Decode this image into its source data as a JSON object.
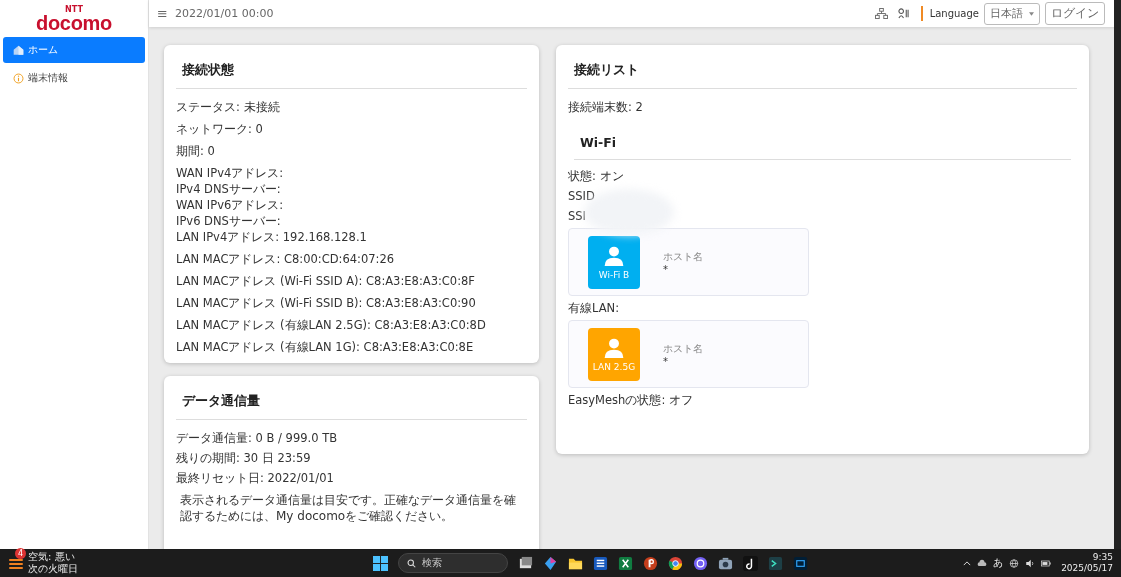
{
  "sidebar": {
    "logo": {
      "brand": "docomo",
      "tag": "NTT"
    },
    "items": [
      {
        "label": "ホーム",
        "selected": true
      },
      {
        "label": "端末情報",
        "selected": false
      }
    ]
  },
  "header": {
    "menu": "≡",
    "datetime": "2022/01/01 00:00",
    "language_label": "Language",
    "language": "日本語",
    "login": "ログイン"
  },
  "connection_status": {
    "title": "接続状態",
    "groups": [
      [
        "ステータス: 未接続"
      ],
      [
        "ネットワーク: 0"
      ],
      [
        "期間: 0"
      ],
      [
        "WAN IPv4アドレス:",
        "IPv4 DNSサーバー:",
        "WAN IPv6アドレス:",
        "IPv6 DNSサーバー:",
        "LAN IPv4アドレス: 192.168.128.1"
      ],
      [
        "LAN MACアドレス: C8:00:CD:64:07:26"
      ],
      [
        "LAN MACアドレス (Wi-Fi SSID A): C8:A3:E8:A3:C0:8F"
      ],
      [
        "LAN MACアドレス (Wi-Fi SSID B): C8:A3:E8:A3:C0:90"
      ],
      [
        "LAN MACアドレス (有線LAN 2.5G): C8:A3:E8:A3:C0:8D"
      ],
      [
        "LAN MACアドレス (有線LAN 1G): C8:A3:E8:A3:C0:8E"
      ]
    ]
  },
  "data_usage": {
    "title": "データ通信量",
    "lines": [
      "データ通信量: 0 B / 999.0 TB",
      "残りの期間: 30 日 23:59",
      "最終リセット日: 2022/01/01"
    ],
    "note": "表示されるデータ通信量は目安です。正確なデータ通信量を確認するためには、My docomoをご確認ください。"
  },
  "connection_list": {
    "title": "接続リスト",
    "count": "接続端末数: 2",
    "wifi": {
      "title": "Wi-Fi",
      "lines": [
        "状態: オン",
        "SSID",
        "SSI"
      ],
      "devices": [
        {
          "tile_label": "Wi-Fi B",
          "color": "#00aff0",
          "host_label": "ホスト名",
          "host": "*"
        }
      ]
    },
    "wired": {
      "title": "有線LAN:",
      "devices": [
        {
          "tile_label": "LAN 2.5G",
          "color": "#ffa500",
          "host_label": "ホスト名",
          "host": "*"
        }
      ]
    },
    "easymesh": "EasyMeshの状態: オフ"
  },
  "taskbar": {
    "weather": {
      "badge": "4",
      "title": "空気: 悪い",
      "subtitle": "次の火曜日"
    },
    "search": "検索",
    "ime": "あ",
    "time": "9:35",
    "date": "2025/05/17"
  }
}
